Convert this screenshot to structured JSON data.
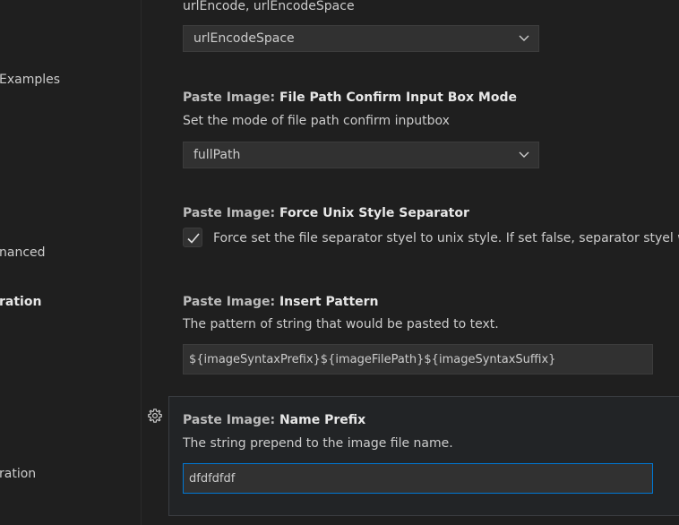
{
  "sidebar": {
    "items": [
      {
        "label": "Examples",
        "active": false
      },
      {
        "label": "nanced",
        "active": false
      },
      {
        "label": "ration",
        "active": true
      },
      {
        "label": "ration",
        "active": false
      }
    ]
  },
  "settings": {
    "encode": {
      "options_text": "urlEncode, urlEncodeSpace",
      "value": "urlEncodeSpace"
    },
    "confirm_mode": {
      "category": "Paste Image: ",
      "name": "File Path Confirm Input Box Mode",
      "description": "Set the mode of file path confirm inputbox",
      "value": "fullPath"
    },
    "unix_separator": {
      "category": "Paste Image: ",
      "name": "Force Unix Style Separator",
      "checked": true,
      "label": "Force set the file separator styel to unix style. If set false, separator styel w"
    },
    "insert_pattern": {
      "category": "Paste Image: ",
      "name": "Insert Pattern",
      "description": "The pattern of string that would be pasted to text.",
      "value": "${imageSyntaxPrefix}${imageFilePath}${imageSyntaxSuffix}"
    },
    "name_prefix": {
      "category": "Paste Image: ",
      "name": "Name Prefix",
      "description": "The string prepend to the image file name.",
      "value": "dfdfdfdf"
    }
  },
  "icons": {
    "dropdown": "chevron-down-icon",
    "check": "check-icon",
    "gear": "gear-icon"
  },
  "colors": {
    "background": "#1f1f1f",
    "input_background": "#313131",
    "focus_border": "#0078d4",
    "text": "#cccccc"
  }
}
